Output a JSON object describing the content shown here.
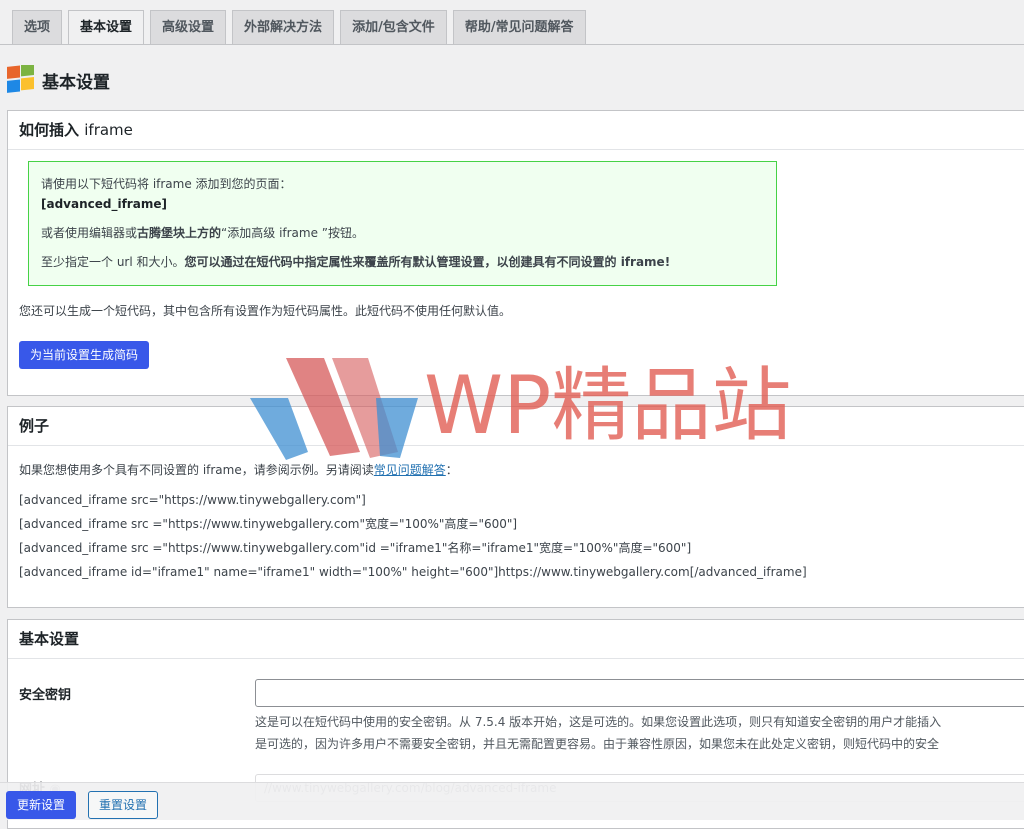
{
  "tabs": [
    {
      "label": "选项",
      "active": false
    },
    {
      "label": "基本设置",
      "active": true
    },
    {
      "label": "高级设置",
      "active": false
    },
    {
      "label": "外部解决方法",
      "active": false
    },
    {
      "label": "添加/包含文件",
      "active": false
    },
    {
      "label": "帮助/常见问题解答",
      "active": false
    }
  ],
  "page": {
    "title": "基本设置",
    "logo_icon": "plugin-logo-icon"
  },
  "insert_box": {
    "title_cn": "如何插入",
    "title_en": "iframe",
    "notice": {
      "line1": "请使用以下短代码将 iframe 添加到您的页面：",
      "shortcode": "[advanced_iframe]",
      "line2_a": "或者使用编辑器或",
      "line2_b": "古腾堡块上方的",
      "line2_c": "“添加高级 iframe ”按钮。",
      "line3_a": "至少指定一个 url 和大小。",
      "line3_b": "您可以通过在短代码中指定属性来覆盖所有默认管理设置，以创建具有不同设置的 iframe!"
    },
    "info": "您还可以生成一个短代码，其中包含所有设置作为短代码属性。此短代码不使用任何默认值。",
    "generate_button": "为当前设置生成简码"
  },
  "example_box": {
    "title": "例子",
    "intro_a": "如果您想使用多个具有不同设置的 iframe，请参阅示例。另请阅读",
    "intro_link": "常见问题解答",
    "intro_b": "：",
    "lines": [
      "[advanced_iframe src=\"https://www.tinywebgallery.com\"]",
      "[advanced_iframe src =\"https://www.tinywebgallery.com\"宽度=\"100%\"高度=\"600\"]",
      "[advanced_iframe src =\"https://www.tinywebgallery.com\"id =\"iframe1\"名称=\"iframe1\"宽度=\"100%\"高度=\"600\"]",
      "[advanced_iframe id=\"iframe1\" name=\"iframe1\" width=\"100%\" height=\"600\"]https://www.tinywebgallery.com[/advanced_iframe]"
    ]
  },
  "basic_box": {
    "title": "基本设置",
    "security_label": "安全密钥",
    "security_value": "",
    "security_desc1": "这是可以在短代码中使用的安全密钥。从 7.5.4 版本开始，这是可选的。如果您设置此选项，则只有知道安全密钥的用户才能插入",
    "security_desc2": "是可选的，因为许多用户不需要安全密钥，并且无需配置更容易。由于兼容性原因，如果您未在此处定义密钥，则短代码中的安全",
    "url_label": "网址",
    "url_placeholder": "//www.tinywebgallery.com/blog/advanced-iframe"
  },
  "footer": {
    "update_button": "更新设置",
    "reset_button": "重置设置"
  },
  "watermark": {
    "text": "WP精品站"
  },
  "colors": {
    "primary": "#3858e9",
    "notice_border": "#46d246",
    "notice_bg": "#f0fff0",
    "link": "#2271b1"
  }
}
